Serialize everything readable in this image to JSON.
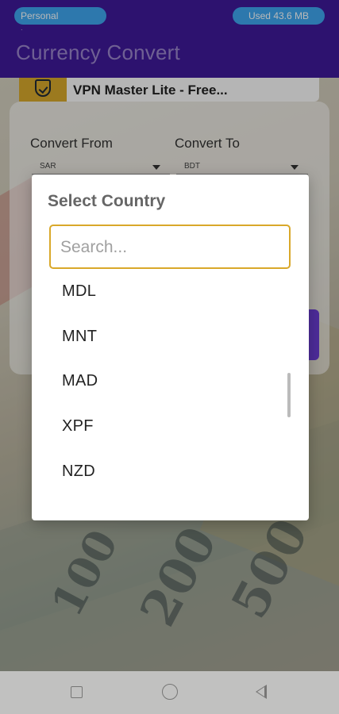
{
  "status_bar": {
    "hotspot_label": "Personal hotspot...",
    "data_usage": "Used  43.6 MB"
  },
  "app_bar": {
    "title": "Currency Convert"
  },
  "ad": {
    "title": "VPN Master Lite - Free..."
  },
  "form": {
    "from_label": "Convert From",
    "from_value": "SAR",
    "to_label": "Convert To",
    "to_value": "BDT"
  },
  "background": {
    "note_numbers": [
      "100",
      "200",
      "500"
    ]
  },
  "dialog": {
    "title": "Select Country",
    "search_placeholder": "Search...",
    "items": [
      "MDL",
      "MNT",
      "MAD",
      "XPF",
      "NZD"
    ]
  },
  "navbar": {
    "icons": [
      "recents-icon",
      "home-icon",
      "back-icon"
    ]
  },
  "colors": {
    "app_bar": "#3f1a9a",
    "status_pill": "#3fa7f0",
    "search_border": "#d9a82a",
    "accent_button": "#5e2bd6"
  }
}
